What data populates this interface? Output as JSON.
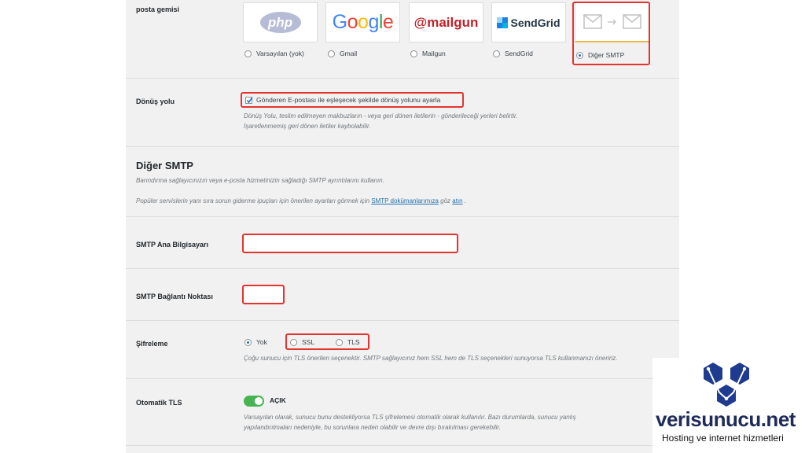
{
  "mailer": {
    "label": "posta gemisi",
    "options": [
      {
        "logo_text": "php",
        "label": "Varsayılan (yok)"
      },
      {
        "logo_text": "Google",
        "label": "Gmail"
      },
      {
        "logo_text": "@mailgun",
        "label": "Mailgun"
      },
      {
        "logo_text": "SendGrid",
        "label": "SendGrid"
      },
      {
        "logo_text": "",
        "label": "Diğer SMTP",
        "selected": true
      }
    ]
  },
  "return_path": {
    "label": "Dönüş yolu",
    "checkbox_label": "Gönderen E-postası ile eşleşecek şekilde dönüş yolunu ayarla",
    "checked": true,
    "desc_line1": "Dönüş Yolu, teslim edilmeyen makbuzların - veya geri dönen iletilerin - gönderileceği yerleri belirtir.",
    "desc_line2": "İşaretlenmemiş geri dönen iletiler kaybolabilir."
  },
  "smtp_section": {
    "title": "Diğer SMTP",
    "desc": "Barındırma sağlayıcınızın veya e-posta hizmetinizin sağladığı SMTP ayrıntılarını kullanın.",
    "tips_before": "Popüler servislerin yanı sıra sorun giderme ipuçları için önerilen ayarları görmek için ",
    "tips_link1": "SMTP dokümanlarımıza",
    "tips_mid": " göz ",
    "tips_link2": "atın",
    "tips_after": " ."
  },
  "smtp_host": {
    "label": "SMTP Ana Bilgisayarı",
    "value": ""
  },
  "smtp_port": {
    "label": "SMTP Bağlantı Noktası",
    "value": ""
  },
  "encryption": {
    "label": "Şifreleme",
    "options": [
      "Yok",
      "SSL",
      "TLS"
    ],
    "selected": "Yok",
    "desc": "Çoğu sunucu için TLS önerilen seçenektir. SMTP sağlayıcınız hem SSL hem de TLS seçenekleri sunuyorsa TLS kullanmanızı öneririz."
  },
  "auto_tls": {
    "label": "Otomatik TLS",
    "state": "AÇIK",
    "desc_line1": "Varsayılan olarak, sunucu bunu destekliyorsa TLS şifrelemesi otomatik olarak kullanılır. Bazı durumlarda, sunucu yanlış",
    "desc_line2": "yapılandırılmaları nedeniyle, bu sorunlara neden olabilir ve devre dışı bırakılması gerekebilir."
  },
  "brand": {
    "name": "verisunucu.net",
    "tagline": "Hosting ve internet hizmetleri",
    "color": "#1e3b8f"
  },
  "colors": {
    "accent": "#2271b1",
    "highlight": "#e3342f",
    "toggle_on": "#46b450"
  }
}
